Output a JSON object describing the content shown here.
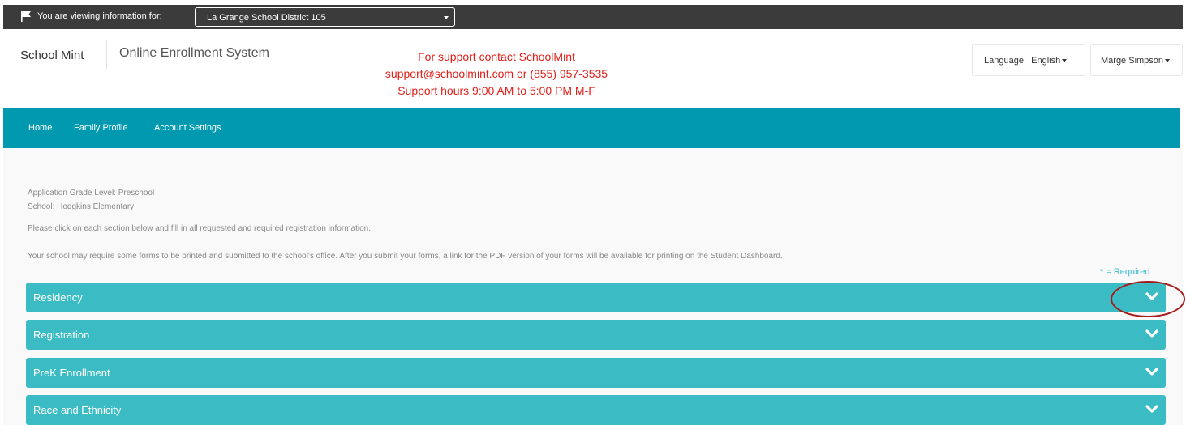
{
  "topbar": {
    "viewing_label": "You are viewing information for:",
    "district": "La Grange School District 105",
    "icons": {
      "flag": "flag-icon",
      "dropdown": "chevron-down-icon"
    }
  },
  "header": {
    "brand": "School Mint",
    "system": "Online Enrollment System",
    "support_link": "For support contact SchoolMint",
    "support_contact": "support@schoolmint.com or (855) 957-3535",
    "support_hours": "Support hours 9:00 AM to 5:00 PM M-F",
    "language_label": "Language:",
    "language_value": "English",
    "user_name": "Marge Simpson"
  },
  "nav": {
    "items": [
      {
        "label": "Home"
      },
      {
        "label": "Family Profile"
      },
      {
        "label": "Account Settings"
      }
    ]
  },
  "main": {
    "grade_level": "Application Grade Level: Preschool",
    "school": "School: Hodgkins Elementary",
    "instruction": "Please click on each section below and fill in all requested and required registration information.",
    "print_note": "Your school may require some forms to be printed and submitted to the school's office. After you submit your forms, a link for the PDF version of your forms will be available for printing on the Student Dashboard.",
    "required_note": "* = Required"
  },
  "sections": [
    {
      "title": "Residency"
    },
    {
      "title": "Registration"
    },
    {
      "title": "PreK Enrollment"
    },
    {
      "title": "Race and Ethnicity"
    }
  ],
  "colors": {
    "topbar": "#3b3b3b",
    "nav": "#0099b0",
    "section": "#3bbbc3",
    "support_text": "#e0201a",
    "highlight_ring": "#a51a1a"
  }
}
